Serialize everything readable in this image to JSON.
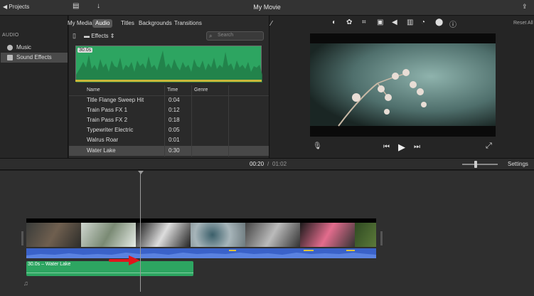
{
  "window": {
    "title": "My Movie",
    "projects_label": "Projects",
    "share_icon": "share-icon"
  },
  "browser": {
    "tabs": [
      {
        "label": "My Media",
        "selected": false
      },
      {
        "label": "Audio",
        "selected": true
      },
      {
        "label": "Titles",
        "selected": false
      },
      {
        "label": "Backgrounds",
        "selected": false
      },
      {
        "label": "Transitions",
        "selected": false
      }
    ],
    "folder_label": "Effects",
    "search_placeholder": "Search",
    "waveform_duration": "30.0s",
    "columns": {
      "name": "Name",
      "time": "Time",
      "genre": "Genre"
    },
    "rows": [
      {
        "name": "Title Flange Sweep Hit",
        "time": "0:04",
        "selected": false
      },
      {
        "name": "Train Pass FX 1",
        "time": "0:12",
        "selected": false
      },
      {
        "name": "Train Pass FX 2",
        "time": "0:18",
        "selected": false
      },
      {
        "name": "Typewriter Electric",
        "time": "0:05",
        "selected": false
      },
      {
        "name": "Walrus Roar",
        "time": "0:01",
        "selected": false
      },
      {
        "name": "Water Lake",
        "time": "0:30",
        "selected": true
      }
    ]
  },
  "sidebar": {
    "heading": "AUDIO",
    "items": [
      {
        "label": "Music",
        "selected": false
      },
      {
        "label": "Sound Effects",
        "selected": true
      }
    ]
  },
  "viewer": {
    "reset_label": "Reset All"
  },
  "timeline": {
    "current_time": "00:20",
    "separator": "/",
    "total_time": "01:02",
    "settings_label": "Settings",
    "sfx_clip_label": "30.0s – Water Lake"
  },
  "colors": {
    "accent_green": "#2da561",
    "audio_blue": "#3a62c9",
    "arrow_red": "#e0151b"
  }
}
